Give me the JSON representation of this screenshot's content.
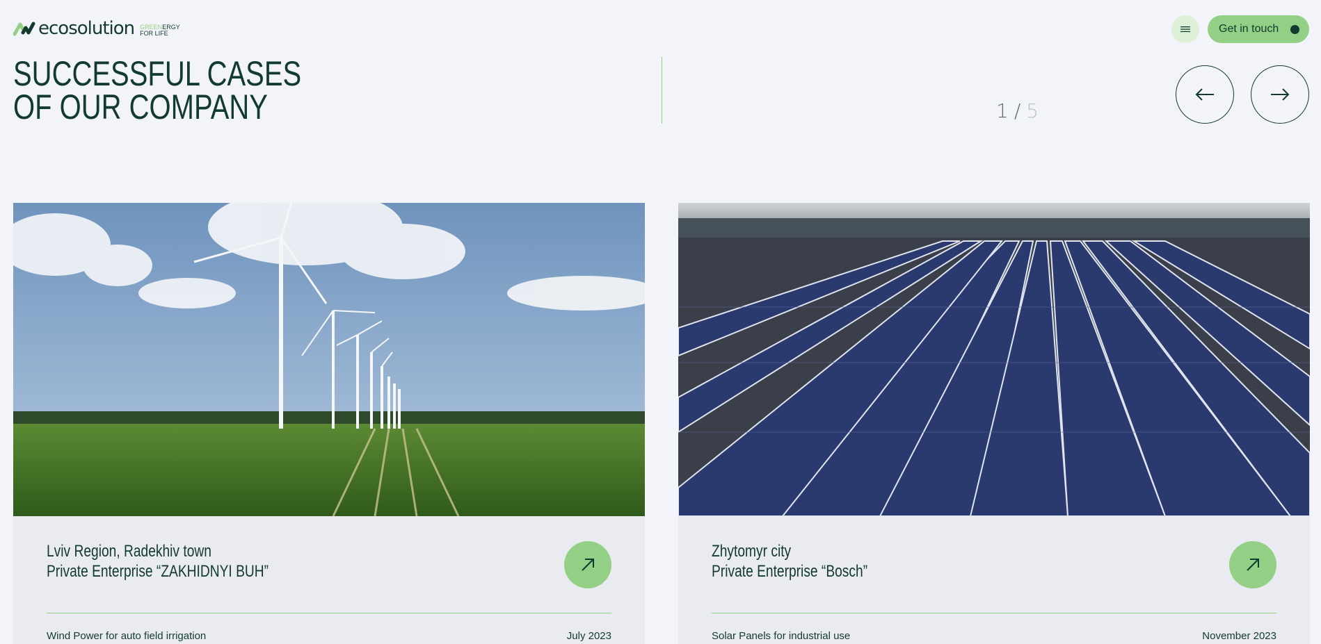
{
  "brand": {
    "name": "ecosolution",
    "tag_line1_green": "GREEN",
    "tag_line1_rest": "ERGY",
    "tag_line2": "FOR LIFE"
  },
  "header": {
    "menu_icon": "hamburger-icon",
    "contact_label": "Get in touch"
  },
  "section": {
    "title_line1": "SUCCESSFUL CASES",
    "title_line2": "OF OUR COMPANY",
    "current_page": "1",
    "separator": "/",
    "total_pages": "5",
    "prev_icon": "arrow-left-icon",
    "next_icon": "arrow-right-icon"
  },
  "cases": [
    {
      "title_line1": "Lviv Region, Radekhiv town",
      "title_line2": "Private Enterprise “ZAKHIDNYI BUH”",
      "category": "Wind Power for auto field irrigation",
      "date": "July 2023",
      "image": "wind-turbines-field-photo"
    },
    {
      "title_line1": "Zhytomyr city",
      "title_line2": "Private Enterprise “Bosch”",
      "category": "Solar Panels for industrial use",
      "date": "November 2023",
      "image": "solar-panels-roof-photo"
    }
  ],
  "colors": {
    "background": "#f2f4f9",
    "accent": "#93cf84",
    "dark": "#123a2e",
    "card": "#e9ebf1"
  }
}
